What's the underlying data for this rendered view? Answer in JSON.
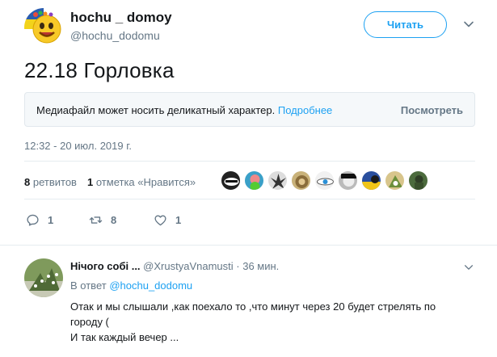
{
  "tweet": {
    "author_name": "hochu _ domoy",
    "author_handle": "@hochu_dodomu",
    "follow_label": "Читать",
    "text": "22.18 Горловка",
    "media_warning": {
      "message": "Медиафайл может носить деликатный характер.",
      "more_link": "Подробнее",
      "view_button": "Посмотреть"
    },
    "timestamp": "12:32 - 20 июл. 2019 г.",
    "stats": {
      "retweets_count": "8",
      "retweets_label": "ретвитов",
      "likes_count": "1",
      "likes_label": "отметка «Нравится»"
    },
    "liker_avatar_count": 9,
    "actions": {
      "reply_count": "1",
      "retweet_count": "8",
      "like_count": "1"
    }
  },
  "reply": {
    "author_name": "Нічого собі ...",
    "author_handle": "@XrustyaVnamusti",
    "separator": "·",
    "time": "36 мин.",
    "in_reply_prefix": "В ответ",
    "in_reply_handle": "@hochu_dodomu",
    "text_lines": [
      "Отак и мы слышали ,как поехало то ,что минут через 20 будет стрелять по",
      "городу (",
      "И так каждый вечер ..."
    ]
  },
  "colors": {
    "accent": "#1da1f2",
    "muted": "#657786",
    "text": "#14171a",
    "panel_bg": "#f5f8fa",
    "border": "#e1e8ed"
  },
  "icons": [
    "emoji-avatar-icon",
    "chevron-down-icon",
    "reply-icon",
    "retweet-icon",
    "heart-icon"
  ]
}
